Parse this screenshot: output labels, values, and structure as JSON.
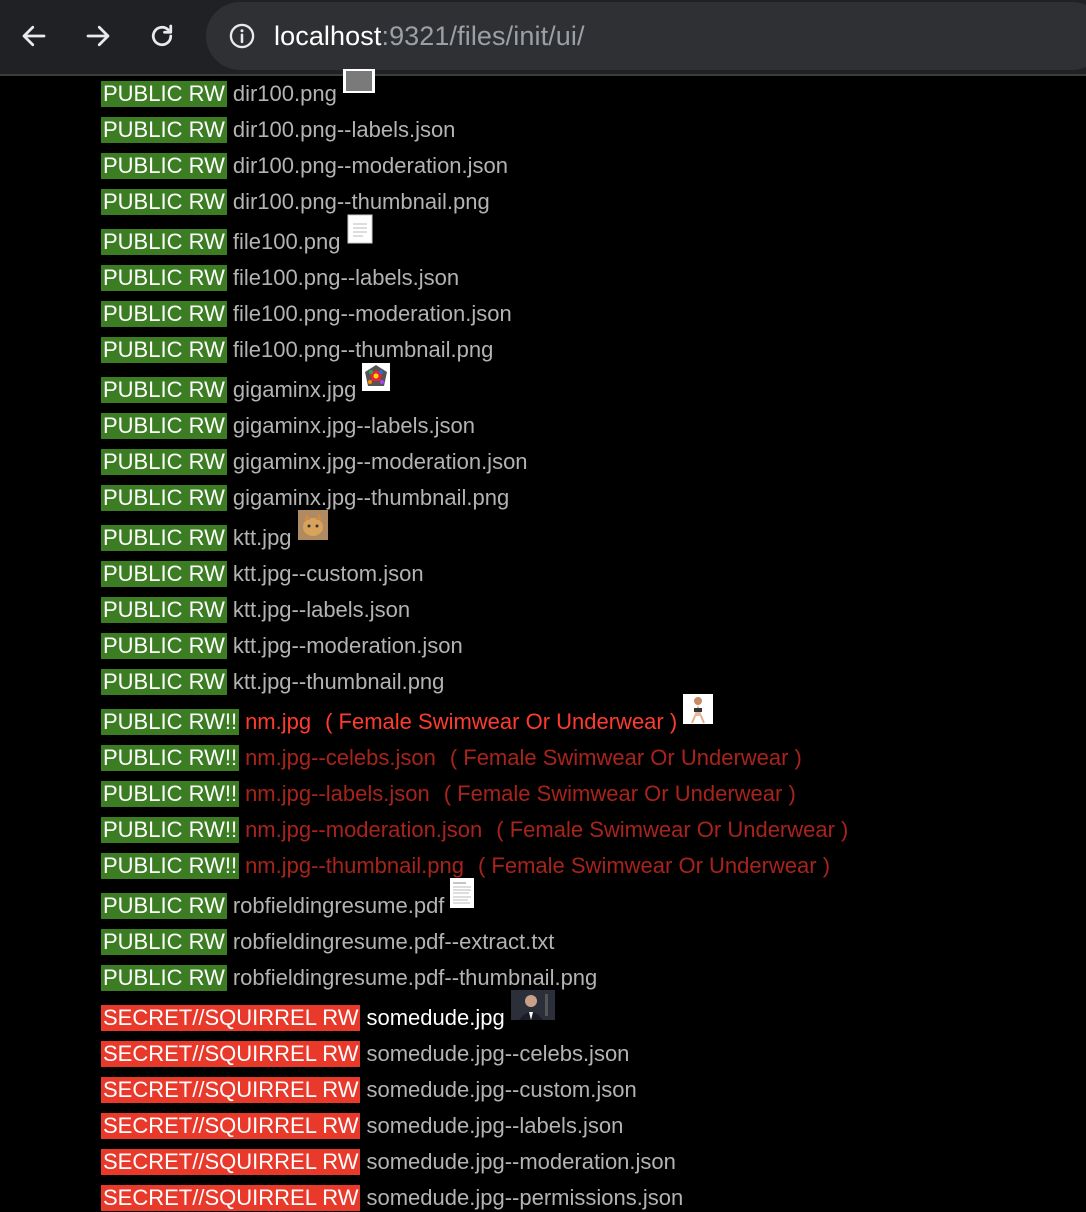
{
  "browser": {
    "url_host": "localhost",
    "url_rest": ":9321/files/init/ui/"
  },
  "files": [
    {
      "badge": "PUBLIC RW",
      "name": "dir100.png"
    },
    {
      "badge": "PUBLIC RW",
      "name": "dir100.png--labels.json"
    },
    {
      "badge": "PUBLIC RW",
      "name": "dir100.png--moderation.json"
    },
    {
      "badge": "PUBLIC RW",
      "name": "dir100.png--thumbnail.png"
    },
    {
      "badge": "PUBLIC RW",
      "name": "file100.png"
    },
    {
      "badge": "PUBLIC RW",
      "name": "file100.png--labels.json"
    },
    {
      "badge": "PUBLIC RW",
      "name": "file100.png--moderation.json"
    },
    {
      "badge": "PUBLIC RW",
      "name": "file100.png--thumbnail.png"
    },
    {
      "badge": "PUBLIC RW",
      "name": "gigaminx.jpg"
    },
    {
      "badge": "PUBLIC RW",
      "name": "gigaminx.jpg--labels.json"
    },
    {
      "badge": "PUBLIC RW",
      "name": "gigaminx.jpg--moderation.json"
    },
    {
      "badge": "PUBLIC RW",
      "name": "gigaminx.jpg--thumbnail.png"
    },
    {
      "badge": "PUBLIC RW",
      "name": "ktt.jpg"
    },
    {
      "badge": "PUBLIC RW",
      "name": "ktt.jpg--custom.json"
    },
    {
      "badge": "PUBLIC RW",
      "name": "ktt.jpg--labels.json"
    },
    {
      "badge": "PUBLIC RW",
      "name": "ktt.jpg--moderation.json"
    },
    {
      "badge": "PUBLIC RW",
      "name": "ktt.jpg--thumbnail.png"
    },
    {
      "badge": "PUBLIC RW!!",
      "name": "nm.jpg",
      "tag": "( Female Swimwear Or Underwear )"
    },
    {
      "badge": "PUBLIC RW!!",
      "name": "nm.jpg--celebs.json",
      "tag": "( Female Swimwear Or Underwear )"
    },
    {
      "badge": "PUBLIC RW!!",
      "name": "nm.jpg--labels.json",
      "tag": "( Female Swimwear Or Underwear )"
    },
    {
      "badge": "PUBLIC RW!!",
      "name": "nm.jpg--moderation.json",
      "tag": "( Female Swimwear Or Underwear )"
    },
    {
      "badge": "PUBLIC RW!!",
      "name": "nm.jpg--thumbnail.png",
      "tag": "( Female Swimwear Or Underwear )"
    },
    {
      "badge": "PUBLIC RW",
      "name": "robfieldingresume.pdf"
    },
    {
      "badge": "PUBLIC RW",
      "name": "robfieldingresume.pdf--extract.txt"
    },
    {
      "badge": "PUBLIC RW",
      "name": "robfieldingresume.pdf--thumbnail.png"
    },
    {
      "badge": "SECRET//SQUIRREL RW",
      "name": "somedude.jpg"
    },
    {
      "badge": "SECRET//SQUIRREL RW",
      "name": "somedude.jpg--celebs.json"
    },
    {
      "badge": "SECRET//SQUIRREL RW",
      "name": "somedude.jpg--custom.json"
    },
    {
      "badge": "SECRET//SQUIRREL RW",
      "name": "somedude.jpg--labels.json"
    },
    {
      "badge": "SECRET//SQUIRREL RW",
      "name": "somedude.jpg--moderation.json"
    },
    {
      "badge": "SECRET//SQUIRREL RW",
      "name": "somedude.jpg--permissions.json"
    }
  ],
  "colors": {
    "public_badge": "#3c7c23",
    "secret_badge": "#e8392b",
    "filename": "#b3b3b3",
    "flagged_primary": "#ff3b2f",
    "flagged_derived": "#a8231b"
  }
}
